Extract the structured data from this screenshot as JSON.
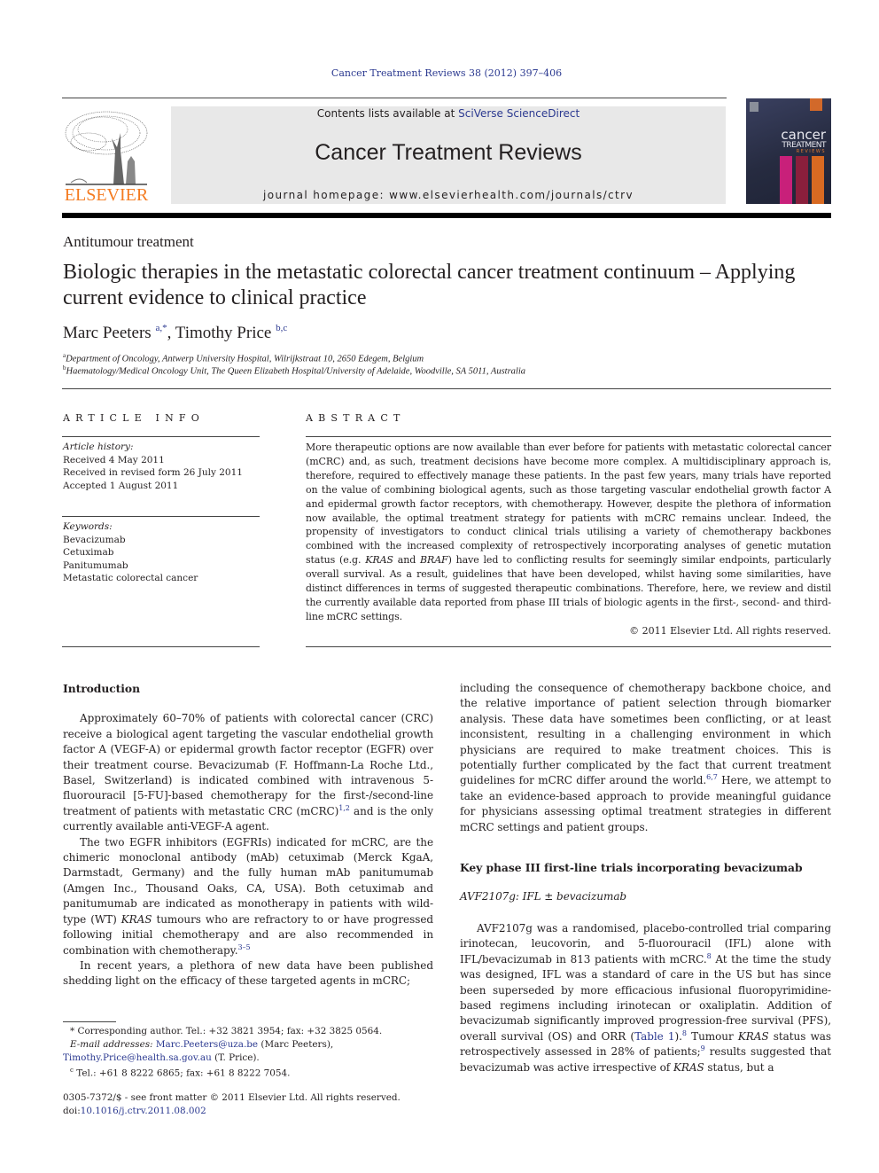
{
  "header": {
    "journal_citation": "Cancer Treatment Reviews 38 (2012) 397–406",
    "contents_prefix": "Contents lists available at ",
    "contents_link": "SciVerse ScienceDirect",
    "journal_name": "Cancer Treatment Reviews",
    "homepage_line": "journal homepage: www.elsevierhealth.com/journals/ctrv",
    "publisher_logo": "ELSEVIER",
    "cover": {
      "line1": "cancer",
      "line2": "TREATMENT",
      "line3": "REVIEWS",
      "strip_colors": [
        "#c8207a",
        "#8a1f3c",
        "#d86a22"
      ]
    },
    "brand_colors": {
      "elsevier_orange": "#f47b20",
      "link_blue": "#2b3990",
      "masthead_gray": "#e8e8e8"
    }
  },
  "article": {
    "section": "Antitumour treatment",
    "title": "Biologic therapies in the metastatic colorectal cancer treatment continuum – Applying current evidence to clinical practice",
    "authors": [
      {
        "name": "Marc Peeters",
        "affil": "a,*"
      },
      {
        "name": "Timothy Price",
        "affil": "b,c"
      }
    ],
    "author_separator": ", ",
    "affiliations": [
      {
        "mark": "a",
        "text": "Department of Oncology, Antwerp University Hospital, Wilrijkstraat 10, 2650 Edegem, Belgium"
      },
      {
        "mark": "b",
        "text": "Haematology/Medical Oncology Unit, The Queen Elizabeth Hospital/University of Adelaide, Woodville, SA 5011, Australia"
      }
    ]
  },
  "article_info": {
    "heading": "ARTICLE INFO",
    "history_label": "Article history:",
    "history": [
      "Received 4 May 2011",
      "Received in revised form 26 July 2011",
      "Accepted 1 August 2011"
    ],
    "keywords_label": "Keywords:",
    "keywords": [
      "Bevacizumab",
      "Cetuximab",
      "Panitumumab",
      "Metastatic colorectal cancer"
    ]
  },
  "abstract": {
    "heading": "ABSTRACT",
    "text_1": "More therapeutic options are now available than ever before for patients with metastatic colorectal cancer (mCRC) and, as such, treatment decisions have become more complex. A multidisciplinary approach is, therefore, required to effectively manage these patients. In the past few years, many trials have reported on the value of combining biological agents, such as those targeting vascular endothelial growth factor A and epidermal growth factor receptors, with chemotherapy. However, despite the plethora of information now available, the optimal treatment strategy for patients with mCRC remains unclear. Indeed, the propensity of investigators to conduct clinical trials utilising a variety of chemotherapy backbones combined with the increased complexity of retrospectively incorporating analyses of genetic mutation status (e.g. ",
    "italic_1": "KRAS",
    "text_2": " and ",
    "italic_2": "BRAF",
    "text_3": ") have led to conflicting results for seemingly similar endpoints, particularly overall survival. As a result, guidelines that have been developed, whilst having some similarities, have distinct differences in terms of suggested therapeutic combinations. Therefore, here, we review and distil the currently available data reported from phase III trials of biologic agents in the first-, second- and third-line mCRC settings.",
    "copyright": "© 2011 Elsevier Ltd. All rights reserved."
  },
  "body": {
    "intro_heading": "Introduction",
    "p1_a": "Approximately 60–70% of patients with colorectal cancer (CRC) receive a biological agent targeting the vascular endothelial growth factor A (VEGF-A) or epidermal growth factor receptor (EGFR) over their treatment course. Bevacizumab (F. Hoffmann-La Roche Ltd., Basel, Switzerland) is indicated combined with intravenous 5-fluorouracil [5-FU]-based chemotherapy for the first-/second-line treatment of patients with metastatic CRC (mCRC)",
    "p1_ref": "1,2",
    "p1_b": " and is the only currently available anti-VEGF-A agent.",
    "p2_a": "The two EGFR inhibitors (EGFRIs) indicated for mCRC, are the chimeric monoclonal antibody (mAb) cetuximab (Merck KgaA, Darmstadt, Germany) and the fully human mAb panitumumab (Amgen Inc., Thousand Oaks, CA, USA). Both cetuximab and panitumumab are indicated as monotherapy in patients with wild-type (WT) ",
    "p2_italic": "KRAS",
    "p2_b": " tumours who are refractory to or have progressed following initial chemotherapy and are also recommended in combination with chemotherapy.",
    "p2_ref": "3–5",
    "p3_a": "In recent years, a plethora of new data have been published shedding light on the efficacy of these targeted agents in mCRC; including the consequence of chemotherapy backbone choice, and the relative importance of patient selection through biomarker analysis. These data have sometimes been conflicting, or at least inconsistent, resulting in a challenging environment in which physicians are required to make treatment choices. This is potentially further complicated by the fact that current treatment guidelines for mCRC differ around the world.",
    "p3_ref": "6,7",
    "p3_b": " Here, we attempt to take an evidence-based approach to provide meaningful guidance for physicians assessing optimal treatment strategies in different mCRC settings and patient groups.",
    "section2_heading": "Key phase III first-line trials incorporating bevacizumab",
    "subsection_heading": "AVF2107g: IFL ± bevacizumab",
    "p4_a": "AVF2107g was a randomised, placebo-controlled trial comparing irinotecan, leucovorin, and 5-fluorouracil (IFL) alone with IFL/bevacizumab in 813 patients with mCRC.",
    "p4_ref1": "8",
    "p4_b": " At the time the study was designed, IFL was a standard of care in the US but has since been superseded by more efficacious infusional fluoropyrimidine-based regimens including irinotecan or oxaliplatin. Addition of bevacizumab significantly improved progression-free survival (PFS), overall survival (OS) and ORR (",
    "p4_table_link": "Table 1",
    "p4_c": ").",
    "p4_ref2": "8",
    "p4_d": " Tumour ",
    "p4_italic1": "KRAS",
    "p4_e": " status was retrospectively assessed in 28% of patients;",
    "p4_ref3": "9",
    "p4_f": " results suggested that bevacizumab was active irrespective of ",
    "p4_italic2": "KRAS",
    "p4_g": " status, but a"
  },
  "footnotes": {
    "corresponding": "Corresponding author. Tel.: +32 3821 3954; fax: +32 3825 0564.",
    "corresponding_mark": "*",
    "email_label": "E-mail addresses:",
    "email1": "Marc.Peeters@uza.be",
    "email1_name": " (Marc Peeters), ",
    "email2": "Timothy.Price@health.sa.gov.au",
    "email2_name": " (T. Price).",
    "c_mark": "c",
    "c_text": "Tel.: +61 8 8222 6865; fax: +61 8 8222 7054.",
    "front_matter": "0305-7372/$ - see front matter © 2011 Elsevier Ltd. All rights reserved.",
    "doi_prefix": "doi:",
    "doi": "10.1016/j.ctrv.2011.08.002"
  }
}
